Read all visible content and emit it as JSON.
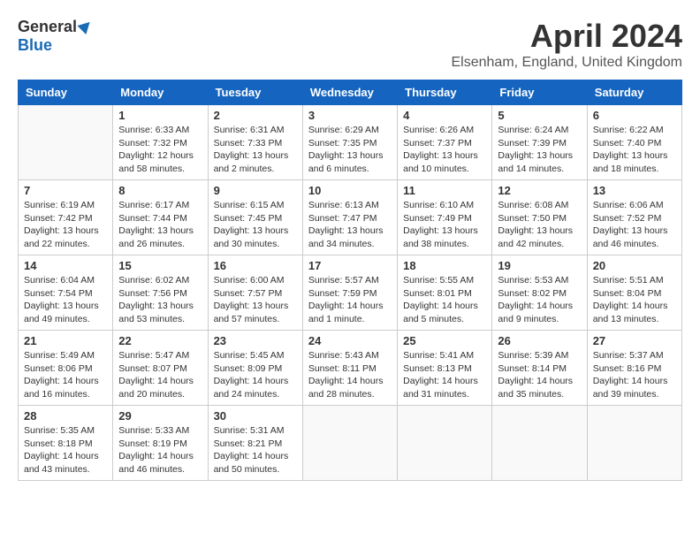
{
  "header": {
    "logo_general": "General",
    "logo_blue": "Blue",
    "month_year": "April 2024",
    "location": "Elsenham, England, United Kingdom"
  },
  "days_of_week": [
    "Sunday",
    "Monday",
    "Tuesday",
    "Wednesday",
    "Thursday",
    "Friday",
    "Saturday"
  ],
  "weeks": [
    [
      {
        "day": "",
        "info": ""
      },
      {
        "day": "1",
        "info": "Sunrise: 6:33 AM\nSunset: 7:32 PM\nDaylight: 12 hours\nand 58 minutes."
      },
      {
        "day": "2",
        "info": "Sunrise: 6:31 AM\nSunset: 7:33 PM\nDaylight: 13 hours\nand 2 minutes."
      },
      {
        "day": "3",
        "info": "Sunrise: 6:29 AM\nSunset: 7:35 PM\nDaylight: 13 hours\nand 6 minutes."
      },
      {
        "day": "4",
        "info": "Sunrise: 6:26 AM\nSunset: 7:37 PM\nDaylight: 13 hours\nand 10 minutes."
      },
      {
        "day": "5",
        "info": "Sunrise: 6:24 AM\nSunset: 7:39 PM\nDaylight: 13 hours\nand 14 minutes."
      },
      {
        "day": "6",
        "info": "Sunrise: 6:22 AM\nSunset: 7:40 PM\nDaylight: 13 hours\nand 18 minutes."
      }
    ],
    [
      {
        "day": "7",
        "info": "Sunrise: 6:19 AM\nSunset: 7:42 PM\nDaylight: 13 hours\nand 22 minutes."
      },
      {
        "day": "8",
        "info": "Sunrise: 6:17 AM\nSunset: 7:44 PM\nDaylight: 13 hours\nand 26 minutes."
      },
      {
        "day": "9",
        "info": "Sunrise: 6:15 AM\nSunset: 7:45 PM\nDaylight: 13 hours\nand 30 minutes."
      },
      {
        "day": "10",
        "info": "Sunrise: 6:13 AM\nSunset: 7:47 PM\nDaylight: 13 hours\nand 34 minutes."
      },
      {
        "day": "11",
        "info": "Sunrise: 6:10 AM\nSunset: 7:49 PM\nDaylight: 13 hours\nand 38 minutes."
      },
      {
        "day": "12",
        "info": "Sunrise: 6:08 AM\nSunset: 7:50 PM\nDaylight: 13 hours\nand 42 minutes."
      },
      {
        "day": "13",
        "info": "Sunrise: 6:06 AM\nSunset: 7:52 PM\nDaylight: 13 hours\nand 46 minutes."
      }
    ],
    [
      {
        "day": "14",
        "info": "Sunrise: 6:04 AM\nSunset: 7:54 PM\nDaylight: 13 hours\nand 49 minutes."
      },
      {
        "day": "15",
        "info": "Sunrise: 6:02 AM\nSunset: 7:56 PM\nDaylight: 13 hours\nand 53 minutes."
      },
      {
        "day": "16",
        "info": "Sunrise: 6:00 AM\nSunset: 7:57 PM\nDaylight: 13 hours\nand 57 minutes."
      },
      {
        "day": "17",
        "info": "Sunrise: 5:57 AM\nSunset: 7:59 PM\nDaylight: 14 hours\nand 1 minute."
      },
      {
        "day": "18",
        "info": "Sunrise: 5:55 AM\nSunset: 8:01 PM\nDaylight: 14 hours\nand 5 minutes."
      },
      {
        "day": "19",
        "info": "Sunrise: 5:53 AM\nSunset: 8:02 PM\nDaylight: 14 hours\nand 9 minutes."
      },
      {
        "day": "20",
        "info": "Sunrise: 5:51 AM\nSunset: 8:04 PM\nDaylight: 14 hours\nand 13 minutes."
      }
    ],
    [
      {
        "day": "21",
        "info": "Sunrise: 5:49 AM\nSunset: 8:06 PM\nDaylight: 14 hours\nand 16 minutes."
      },
      {
        "day": "22",
        "info": "Sunrise: 5:47 AM\nSunset: 8:07 PM\nDaylight: 14 hours\nand 20 minutes."
      },
      {
        "day": "23",
        "info": "Sunrise: 5:45 AM\nSunset: 8:09 PM\nDaylight: 14 hours\nand 24 minutes."
      },
      {
        "day": "24",
        "info": "Sunrise: 5:43 AM\nSunset: 8:11 PM\nDaylight: 14 hours\nand 28 minutes."
      },
      {
        "day": "25",
        "info": "Sunrise: 5:41 AM\nSunset: 8:13 PM\nDaylight: 14 hours\nand 31 minutes."
      },
      {
        "day": "26",
        "info": "Sunrise: 5:39 AM\nSunset: 8:14 PM\nDaylight: 14 hours\nand 35 minutes."
      },
      {
        "day": "27",
        "info": "Sunrise: 5:37 AM\nSunset: 8:16 PM\nDaylight: 14 hours\nand 39 minutes."
      }
    ],
    [
      {
        "day": "28",
        "info": "Sunrise: 5:35 AM\nSunset: 8:18 PM\nDaylight: 14 hours\nand 43 minutes."
      },
      {
        "day": "29",
        "info": "Sunrise: 5:33 AM\nSunset: 8:19 PM\nDaylight: 14 hours\nand 46 minutes."
      },
      {
        "day": "30",
        "info": "Sunrise: 5:31 AM\nSunset: 8:21 PM\nDaylight: 14 hours\nand 50 minutes."
      },
      {
        "day": "",
        "info": ""
      },
      {
        "day": "",
        "info": ""
      },
      {
        "day": "",
        "info": ""
      },
      {
        "day": "",
        "info": ""
      }
    ]
  ]
}
